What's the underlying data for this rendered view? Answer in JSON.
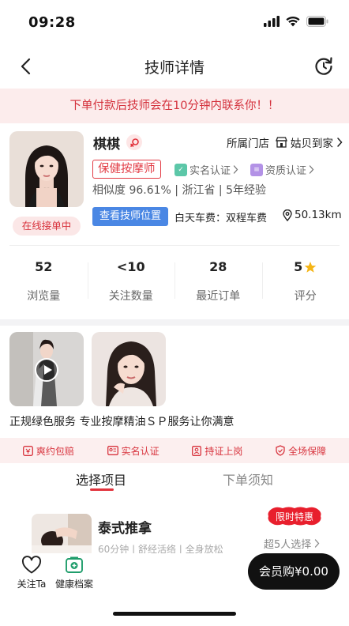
{
  "status_bar": {
    "time": "09:28"
  },
  "nav": {
    "title": "技师详情"
  },
  "notice": {
    "text": "下单付款后技师会在10分钟内联系你！！"
  },
  "profile": {
    "name": "棋棋",
    "online_status": "在线接单中",
    "store_label": "所属门店",
    "store_name": "姑贝到家",
    "tag": "保健按摩师",
    "realname_verify": "实名认证",
    "qualification_verify": "资质认证",
    "stats_line": "相似度 96.61% | 浙江省 | 5年经验",
    "location_button": "查看技师位置",
    "car_fee": "白天车费：双程车费",
    "distance": "50.13km"
  },
  "stats": [
    {
      "value": "52",
      "label": "浏览量"
    },
    {
      "value": "<10",
      "label": "关注数量"
    },
    {
      "value": "28",
      "label": "最近订单"
    },
    {
      "value": "5",
      "label": "评分"
    }
  ],
  "media": {
    "intro": "正规绿色服务 专业按摩精油ＳＰ服务让你满意"
  },
  "guarantees": [
    {
      "label": "爽约包赔"
    },
    {
      "label": "实名认证"
    },
    {
      "label": "持证上岗"
    },
    {
      "label": "全场保障"
    }
  ],
  "tabs": [
    {
      "label": "选择项目",
      "active": true
    },
    {
      "label": "下单须知",
      "active": false
    }
  ],
  "service": {
    "name": "泰式推拿",
    "desc": "60分钟 | 舒经活络 | 全身放松",
    "badge": "限时特惠",
    "booked": "超5人选择"
  },
  "bottom_bar": {
    "follow_label": "关注Ta",
    "health_label": "健康档案",
    "member_button": "会员购¥0.00"
  },
  "colors": {
    "accent_red": "#e2323c",
    "notice_bg": "#fcecec",
    "location_blue": "#4a87e4",
    "dark_button": "#111111"
  }
}
